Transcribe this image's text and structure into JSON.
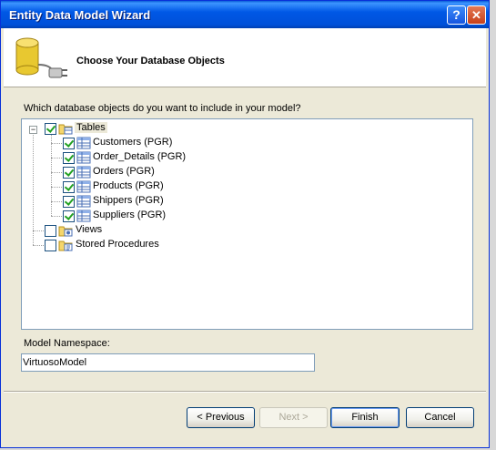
{
  "window": {
    "title": "Entity Data Model Wizard",
    "help_symbol": "?",
    "close_symbol": "✕"
  },
  "header": {
    "title": "Choose Your Database Objects",
    "icon": "database-plug-icon"
  },
  "prompt": "Which database objects do you want to include in your model?",
  "tree": {
    "tables": {
      "label": "Tables",
      "checked": true,
      "expanded": true
    },
    "table_items": [
      {
        "label": "Customers (PGR)",
        "checked": true
      },
      {
        "label": "Order_Details (PGR)",
        "checked": true
      },
      {
        "label": "Orders (PGR)",
        "checked": true
      },
      {
        "label": "Products (PGR)",
        "checked": true
      },
      {
        "label": "Shippers (PGR)",
        "checked": true
      },
      {
        "label": "Suppliers (PGR)",
        "checked": true
      }
    ],
    "views": {
      "label": "Views",
      "checked": false
    },
    "procedures": {
      "label": "Stored Procedures",
      "checked": false
    },
    "expand_symbol": "−"
  },
  "namespace": {
    "label": "Model Namespace:",
    "value": "VirtuosoModel"
  },
  "buttons": {
    "previous": "< Previous",
    "next": "Next >",
    "finish": "Finish",
    "cancel": "Cancel"
  },
  "colors": {
    "titlebar": "#0058e6",
    "dialog_bg": "#ece9d8",
    "check_green": "#21a121"
  }
}
